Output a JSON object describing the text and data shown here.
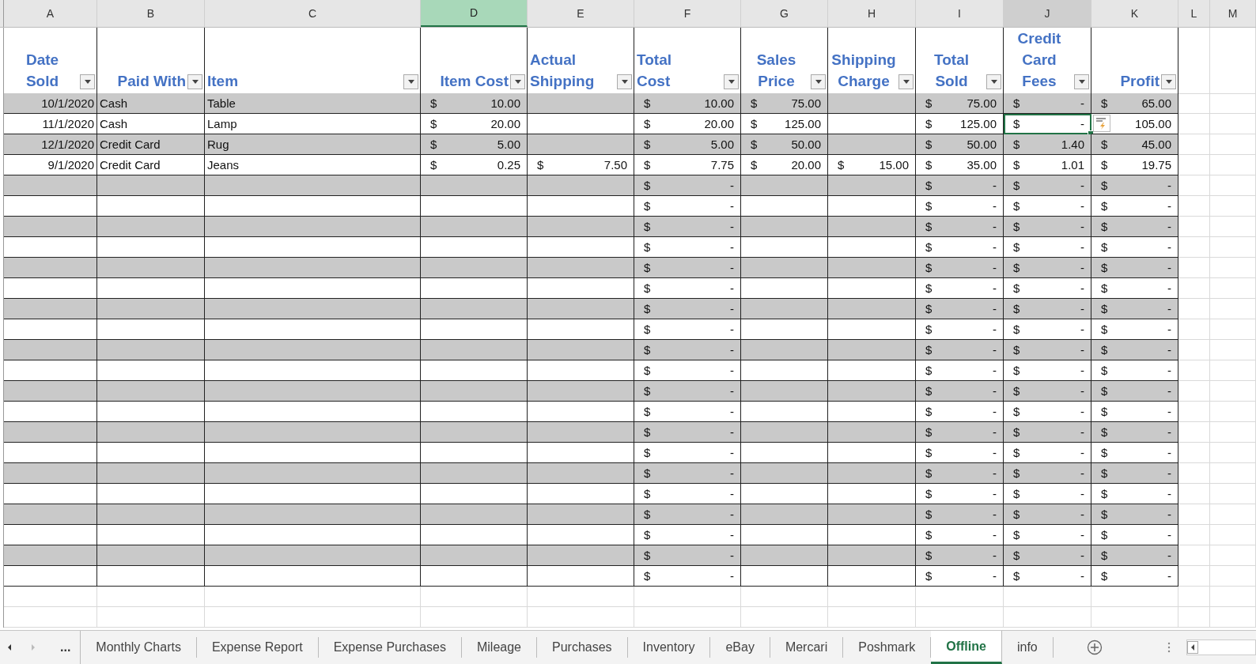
{
  "columns": [
    {
      "label": "A",
      "selected": false,
      "highlighted": false
    },
    {
      "label": "B",
      "selected": false,
      "highlighted": false
    },
    {
      "label": "C",
      "selected": false,
      "highlighted": false
    },
    {
      "label": "D",
      "selected": true,
      "highlighted": false
    },
    {
      "label": "E",
      "selected": false,
      "highlighted": false
    },
    {
      "label": "F",
      "selected": false,
      "highlighted": false
    },
    {
      "label": "G",
      "selected": false,
      "highlighted": false
    },
    {
      "label": "H",
      "selected": false,
      "highlighted": false
    },
    {
      "label": "I",
      "selected": false,
      "highlighted": false
    },
    {
      "label": "J",
      "selected": false,
      "highlighted": true
    },
    {
      "label": "K",
      "selected": false,
      "highlighted": false
    },
    {
      "label": "L",
      "selected": false,
      "highlighted": false
    },
    {
      "label": "M",
      "selected": false,
      "highlighted": false
    }
  ],
  "table": {
    "headers": [
      {
        "lines": [
          "Date",
          "Sold"
        ]
      },
      {
        "lines": [
          "Paid With"
        ]
      },
      {
        "lines": [
          "Item"
        ]
      },
      {
        "lines": [
          "Item Cost"
        ]
      },
      {
        "lines": [
          "Actual",
          "Shipping"
        ]
      },
      {
        "lines": [
          "Total",
          "Cost"
        ]
      },
      {
        "lines": [
          "Sales",
          "Price"
        ]
      },
      {
        "lines": [
          "Shipping",
          "Charge"
        ]
      },
      {
        "lines": [
          "Total",
          "Sold"
        ]
      },
      {
        "lines": [
          "Credit",
          "Card",
          "Fees"
        ]
      },
      {
        "lines": [
          "Profit"
        ]
      }
    ],
    "rows": [
      {
        "shaded": true,
        "cells": [
          {
            "kind": "date",
            "text": "10/1/2020"
          },
          {
            "kind": "text",
            "text": "Cash"
          },
          {
            "kind": "text",
            "text": "Table"
          },
          {
            "kind": "money",
            "symbol": "$",
            "amount": "10.00"
          },
          {
            "kind": "empty"
          },
          {
            "kind": "money",
            "symbol": "$",
            "amount": "10.00"
          },
          {
            "kind": "money",
            "symbol": "$",
            "amount": "75.00"
          },
          {
            "kind": "empty"
          },
          {
            "kind": "money",
            "symbol": "$",
            "amount": "75.00"
          },
          {
            "kind": "money",
            "symbol": "$",
            "amount": "-"
          },
          {
            "kind": "money",
            "symbol": "$",
            "amount": "65.00"
          }
        ]
      },
      {
        "shaded": false,
        "cells": [
          {
            "kind": "date",
            "text": "11/1/2020"
          },
          {
            "kind": "text",
            "text": "Cash"
          },
          {
            "kind": "text",
            "text": "Lamp"
          },
          {
            "kind": "money",
            "symbol": "$",
            "amount": "20.00"
          },
          {
            "kind": "empty"
          },
          {
            "kind": "money",
            "symbol": "$",
            "amount": "20.00"
          },
          {
            "kind": "money",
            "symbol": "$",
            "amount": "125.00"
          },
          {
            "kind": "empty"
          },
          {
            "kind": "money",
            "symbol": "$",
            "amount": "125.00"
          },
          {
            "kind": "money",
            "symbol": "$",
            "amount": "-",
            "active": true
          },
          {
            "kind": "money",
            "amount": "105.00"
          }
        ]
      },
      {
        "shaded": true,
        "cells": [
          {
            "kind": "date",
            "text": "12/1/2020"
          },
          {
            "kind": "text",
            "text": "Credit Card"
          },
          {
            "kind": "text",
            "text": "Rug"
          },
          {
            "kind": "money",
            "symbol": "$",
            "amount": "5.00"
          },
          {
            "kind": "empty"
          },
          {
            "kind": "money",
            "symbol": "$",
            "amount": "5.00"
          },
          {
            "kind": "money",
            "symbol": "$",
            "amount": "50.00"
          },
          {
            "kind": "empty"
          },
          {
            "kind": "money",
            "symbol": "$",
            "amount": "50.00"
          },
          {
            "kind": "money",
            "symbol": "$",
            "amount": "1.40"
          },
          {
            "kind": "money",
            "symbol": "$",
            "amount": "45.00"
          }
        ]
      },
      {
        "shaded": false,
        "cells": [
          {
            "kind": "date",
            "text": "9/1/2020"
          },
          {
            "kind": "text",
            "text": "Credit Card"
          },
          {
            "kind": "text",
            "text": "Jeans"
          },
          {
            "kind": "money",
            "symbol": "$",
            "amount": "0.25"
          },
          {
            "kind": "money",
            "symbol": "$",
            "amount": "7.50"
          },
          {
            "kind": "money",
            "symbol": "$",
            "amount": "7.75"
          },
          {
            "kind": "money",
            "symbol": "$",
            "amount": "20.00"
          },
          {
            "kind": "money",
            "symbol": "$",
            "amount": "15.00"
          },
          {
            "kind": "money",
            "symbol": "$",
            "amount": "35.00"
          },
          {
            "kind": "money",
            "symbol": "$",
            "amount": "1.01"
          },
          {
            "kind": "money",
            "symbol": "$",
            "amount": "19.75"
          }
        ]
      },
      {
        "shaded": true,
        "cells": [
          {
            "kind": "empty"
          },
          {
            "kind": "empty"
          },
          {
            "kind": "empty"
          },
          {
            "kind": "empty"
          },
          {
            "kind": "empty"
          },
          {
            "kind": "money",
            "symbol": "$",
            "amount": "-"
          },
          {
            "kind": "empty"
          },
          {
            "kind": "empty"
          },
          {
            "kind": "money",
            "symbol": "$",
            "amount": "-"
          },
          {
            "kind": "money",
            "symbol": "$",
            "amount": "-"
          },
          {
            "kind": "money",
            "symbol": "$",
            "amount": "-"
          }
        ]
      },
      {
        "shaded": false,
        "cells": [
          {
            "kind": "empty"
          },
          {
            "kind": "empty"
          },
          {
            "kind": "empty"
          },
          {
            "kind": "empty"
          },
          {
            "kind": "empty"
          },
          {
            "kind": "money",
            "symbol": "$",
            "amount": "-"
          },
          {
            "kind": "empty"
          },
          {
            "kind": "empty"
          },
          {
            "kind": "money",
            "symbol": "$",
            "amount": "-"
          },
          {
            "kind": "money",
            "symbol": "$",
            "amount": "-"
          },
          {
            "kind": "money",
            "symbol": "$",
            "amount": "-"
          }
        ]
      },
      {
        "shaded": true,
        "cells": [
          {
            "kind": "empty"
          },
          {
            "kind": "empty"
          },
          {
            "kind": "empty"
          },
          {
            "kind": "empty"
          },
          {
            "kind": "empty"
          },
          {
            "kind": "money",
            "symbol": "$",
            "amount": "-"
          },
          {
            "kind": "empty"
          },
          {
            "kind": "empty"
          },
          {
            "kind": "money",
            "symbol": "$",
            "amount": "-"
          },
          {
            "kind": "money",
            "symbol": "$",
            "amount": "-"
          },
          {
            "kind": "money",
            "symbol": "$",
            "amount": "-"
          }
        ]
      },
      {
        "shaded": false,
        "cells": [
          {
            "kind": "empty"
          },
          {
            "kind": "empty"
          },
          {
            "kind": "empty"
          },
          {
            "kind": "empty"
          },
          {
            "kind": "empty"
          },
          {
            "kind": "money",
            "symbol": "$",
            "amount": "-"
          },
          {
            "kind": "empty"
          },
          {
            "kind": "empty"
          },
          {
            "kind": "money",
            "symbol": "$",
            "amount": "-"
          },
          {
            "kind": "money",
            "symbol": "$",
            "amount": "-"
          },
          {
            "kind": "money",
            "symbol": "$",
            "amount": "-"
          }
        ]
      },
      {
        "shaded": true,
        "cells": [
          {
            "kind": "empty"
          },
          {
            "kind": "empty"
          },
          {
            "kind": "empty"
          },
          {
            "kind": "empty"
          },
          {
            "kind": "empty"
          },
          {
            "kind": "money",
            "symbol": "$",
            "amount": "-"
          },
          {
            "kind": "empty"
          },
          {
            "kind": "empty"
          },
          {
            "kind": "money",
            "symbol": "$",
            "amount": "-"
          },
          {
            "kind": "money",
            "symbol": "$",
            "amount": "-"
          },
          {
            "kind": "money",
            "symbol": "$",
            "amount": "-"
          }
        ]
      },
      {
        "shaded": false,
        "cells": [
          {
            "kind": "empty"
          },
          {
            "kind": "empty"
          },
          {
            "kind": "empty"
          },
          {
            "kind": "empty"
          },
          {
            "kind": "empty"
          },
          {
            "kind": "money",
            "symbol": "$",
            "amount": "-"
          },
          {
            "kind": "empty"
          },
          {
            "kind": "empty"
          },
          {
            "kind": "money",
            "symbol": "$",
            "amount": "-"
          },
          {
            "kind": "money",
            "symbol": "$",
            "amount": "-"
          },
          {
            "kind": "money",
            "symbol": "$",
            "amount": "-"
          }
        ]
      },
      {
        "shaded": true,
        "cells": [
          {
            "kind": "empty"
          },
          {
            "kind": "empty"
          },
          {
            "kind": "empty"
          },
          {
            "kind": "empty"
          },
          {
            "kind": "empty"
          },
          {
            "kind": "money",
            "symbol": "$",
            "amount": "-"
          },
          {
            "kind": "empty"
          },
          {
            "kind": "empty"
          },
          {
            "kind": "money",
            "symbol": "$",
            "amount": "-"
          },
          {
            "kind": "money",
            "symbol": "$",
            "amount": "-"
          },
          {
            "kind": "money",
            "symbol": "$",
            "amount": "-"
          }
        ]
      },
      {
        "shaded": false,
        "cells": [
          {
            "kind": "empty"
          },
          {
            "kind": "empty"
          },
          {
            "kind": "empty"
          },
          {
            "kind": "empty"
          },
          {
            "kind": "empty"
          },
          {
            "kind": "money",
            "symbol": "$",
            "amount": "-"
          },
          {
            "kind": "empty"
          },
          {
            "kind": "empty"
          },
          {
            "kind": "money",
            "symbol": "$",
            "amount": "-"
          },
          {
            "kind": "money",
            "symbol": "$",
            "amount": "-"
          },
          {
            "kind": "money",
            "symbol": "$",
            "amount": "-"
          }
        ]
      },
      {
        "shaded": true,
        "cells": [
          {
            "kind": "empty"
          },
          {
            "kind": "empty"
          },
          {
            "kind": "empty"
          },
          {
            "kind": "empty"
          },
          {
            "kind": "empty"
          },
          {
            "kind": "money",
            "symbol": "$",
            "amount": "-"
          },
          {
            "kind": "empty"
          },
          {
            "kind": "empty"
          },
          {
            "kind": "money",
            "symbol": "$",
            "amount": "-"
          },
          {
            "kind": "money",
            "symbol": "$",
            "amount": "-"
          },
          {
            "kind": "money",
            "symbol": "$",
            "amount": "-"
          }
        ]
      },
      {
        "shaded": false,
        "cells": [
          {
            "kind": "empty"
          },
          {
            "kind": "empty"
          },
          {
            "kind": "empty"
          },
          {
            "kind": "empty"
          },
          {
            "kind": "empty"
          },
          {
            "kind": "money",
            "symbol": "$",
            "amount": "-"
          },
          {
            "kind": "empty"
          },
          {
            "kind": "empty"
          },
          {
            "kind": "money",
            "symbol": "$",
            "amount": "-"
          },
          {
            "kind": "money",
            "symbol": "$",
            "amount": "-"
          },
          {
            "kind": "money",
            "symbol": "$",
            "amount": "-"
          }
        ]
      },
      {
        "shaded": true,
        "cells": [
          {
            "kind": "empty"
          },
          {
            "kind": "empty"
          },
          {
            "kind": "empty"
          },
          {
            "kind": "empty"
          },
          {
            "kind": "empty"
          },
          {
            "kind": "money",
            "symbol": "$",
            "amount": "-"
          },
          {
            "kind": "empty"
          },
          {
            "kind": "empty"
          },
          {
            "kind": "money",
            "symbol": "$",
            "amount": "-"
          },
          {
            "kind": "money",
            "symbol": "$",
            "amount": "-"
          },
          {
            "kind": "money",
            "symbol": "$",
            "amount": "-"
          }
        ]
      },
      {
        "shaded": false,
        "cells": [
          {
            "kind": "empty"
          },
          {
            "kind": "empty"
          },
          {
            "kind": "empty"
          },
          {
            "kind": "empty"
          },
          {
            "kind": "empty"
          },
          {
            "kind": "money",
            "symbol": "$",
            "amount": "-"
          },
          {
            "kind": "empty"
          },
          {
            "kind": "empty"
          },
          {
            "kind": "money",
            "symbol": "$",
            "amount": "-"
          },
          {
            "kind": "money",
            "symbol": "$",
            "amount": "-"
          },
          {
            "kind": "money",
            "symbol": "$",
            "amount": "-"
          }
        ]
      },
      {
        "shaded": true,
        "cells": [
          {
            "kind": "empty"
          },
          {
            "kind": "empty"
          },
          {
            "kind": "empty"
          },
          {
            "kind": "empty"
          },
          {
            "kind": "empty"
          },
          {
            "kind": "money",
            "symbol": "$",
            "amount": "-"
          },
          {
            "kind": "empty"
          },
          {
            "kind": "empty"
          },
          {
            "kind": "money",
            "symbol": "$",
            "amount": "-"
          },
          {
            "kind": "money",
            "symbol": "$",
            "amount": "-"
          },
          {
            "kind": "money",
            "symbol": "$",
            "amount": "-"
          }
        ]
      },
      {
        "shaded": false,
        "cells": [
          {
            "kind": "empty"
          },
          {
            "kind": "empty"
          },
          {
            "kind": "empty"
          },
          {
            "kind": "empty"
          },
          {
            "kind": "empty"
          },
          {
            "kind": "money",
            "symbol": "$",
            "amount": "-"
          },
          {
            "kind": "empty"
          },
          {
            "kind": "empty"
          },
          {
            "kind": "money",
            "symbol": "$",
            "amount": "-"
          },
          {
            "kind": "money",
            "symbol": "$",
            "amount": "-"
          },
          {
            "kind": "money",
            "symbol": "$",
            "amount": "-"
          }
        ]
      },
      {
        "shaded": true,
        "cells": [
          {
            "kind": "empty"
          },
          {
            "kind": "empty"
          },
          {
            "kind": "empty"
          },
          {
            "kind": "empty"
          },
          {
            "kind": "empty"
          },
          {
            "kind": "money",
            "symbol": "$",
            "amount": "-"
          },
          {
            "kind": "empty"
          },
          {
            "kind": "empty"
          },
          {
            "kind": "money",
            "symbol": "$",
            "amount": "-"
          },
          {
            "kind": "money",
            "symbol": "$",
            "amount": "-"
          },
          {
            "kind": "money",
            "symbol": "$",
            "amount": "-"
          }
        ]
      },
      {
        "shaded": false,
        "cells": [
          {
            "kind": "empty"
          },
          {
            "kind": "empty"
          },
          {
            "kind": "empty"
          },
          {
            "kind": "empty"
          },
          {
            "kind": "empty"
          },
          {
            "kind": "money",
            "symbol": "$",
            "amount": "-"
          },
          {
            "kind": "empty"
          },
          {
            "kind": "empty"
          },
          {
            "kind": "money",
            "symbol": "$",
            "amount": "-"
          },
          {
            "kind": "money",
            "symbol": "$",
            "amount": "-"
          },
          {
            "kind": "money",
            "symbol": "$",
            "amount": "-"
          }
        ]
      },
      {
        "shaded": true,
        "cells": [
          {
            "kind": "empty"
          },
          {
            "kind": "empty"
          },
          {
            "kind": "empty"
          },
          {
            "kind": "empty"
          },
          {
            "kind": "empty"
          },
          {
            "kind": "money",
            "symbol": "$",
            "amount": "-"
          },
          {
            "kind": "empty"
          },
          {
            "kind": "empty"
          },
          {
            "kind": "money",
            "symbol": "$",
            "amount": "-"
          },
          {
            "kind": "money",
            "symbol": "$",
            "amount": "-"
          },
          {
            "kind": "money",
            "symbol": "$",
            "amount": "-"
          }
        ]
      },
      {
        "shaded": false,
        "cells": [
          {
            "kind": "empty"
          },
          {
            "kind": "empty"
          },
          {
            "kind": "empty"
          },
          {
            "kind": "empty"
          },
          {
            "kind": "empty"
          },
          {
            "kind": "money",
            "symbol": "$",
            "amount": "-"
          },
          {
            "kind": "empty"
          },
          {
            "kind": "empty"
          },
          {
            "kind": "money",
            "symbol": "$",
            "amount": "-"
          },
          {
            "kind": "money",
            "symbol": "$",
            "amount": "-"
          },
          {
            "kind": "money",
            "symbol": "$",
            "amount": "-"
          }
        ]
      },
      {
        "shaded": true,
        "cells": [
          {
            "kind": "empty"
          },
          {
            "kind": "empty"
          },
          {
            "kind": "empty"
          },
          {
            "kind": "empty"
          },
          {
            "kind": "empty"
          },
          {
            "kind": "money",
            "symbol": "$",
            "amount": "-"
          },
          {
            "kind": "empty"
          },
          {
            "kind": "empty"
          },
          {
            "kind": "money",
            "symbol": "$",
            "amount": "-"
          },
          {
            "kind": "money",
            "symbol": "$",
            "amount": "-"
          },
          {
            "kind": "money",
            "symbol": "$",
            "amount": "-"
          }
        ]
      },
      {
        "shaded": false,
        "cells": [
          {
            "kind": "empty"
          },
          {
            "kind": "empty"
          },
          {
            "kind": "empty"
          },
          {
            "kind": "empty"
          },
          {
            "kind": "empty"
          },
          {
            "kind": "money",
            "symbol": "$",
            "amount": "-"
          },
          {
            "kind": "empty"
          },
          {
            "kind": "empty"
          },
          {
            "kind": "money",
            "symbol": "$",
            "amount": "-"
          },
          {
            "kind": "money",
            "symbol": "$",
            "amount": "-"
          },
          {
            "kind": "money",
            "symbol": "$",
            "amount": "-"
          }
        ]
      }
    ]
  },
  "sheet_tabs": {
    "more": "...",
    "tabs": [
      {
        "label": "Monthly Charts",
        "selected": false
      },
      {
        "label": "Expense Report",
        "selected": false
      },
      {
        "label": "Expense Purchases",
        "selected": false
      },
      {
        "label": "Mileage",
        "selected": false
      },
      {
        "label": "Purchases",
        "selected": false
      },
      {
        "label": "Inventory",
        "selected": false
      },
      {
        "label": "eBay",
        "selected": false
      },
      {
        "label": "Mercari",
        "selected": false
      },
      {
        "label": "Poshmark",
        "selected": false
      },
      {
        "label": "Offline",
        "selected": true
      },
      {
        "label": "info",
        "selected": false
      }
    ]
  }
}
